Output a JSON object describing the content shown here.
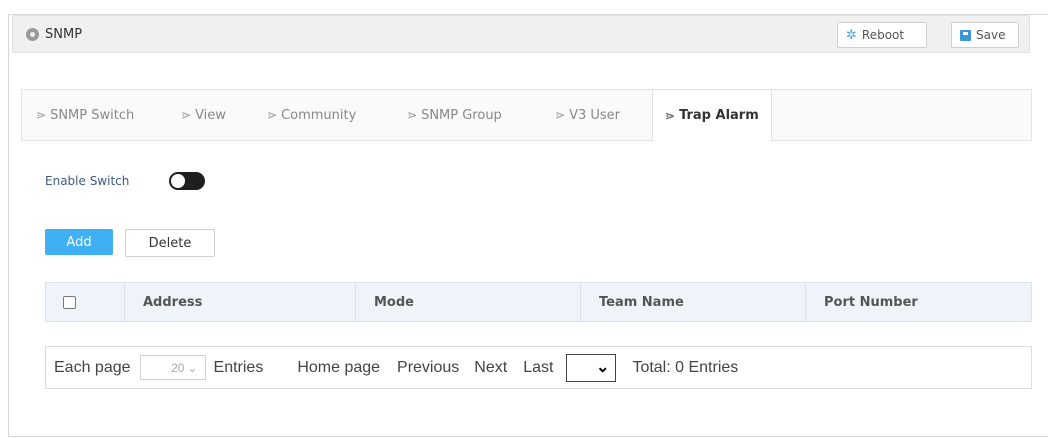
{
  "header": {
    "title": "SNMP",
    "reboot_label": "Reboot",
    "save_label": "Save"
  },
  "tabs": [
    {
      "label": "SNMP Switch",
      "active": false
    },
    {
      "label": "View",
      "active": false
    },
    {
      "label": "Community",
      "active": false
    },
    {
      "label": "SNMP Group",
      "active": false
    },
    {
      "label": "V3 User",
      "active": false
    },
    {
      "label": "Trap Alarm",
      "active": true
    }
  ],
  "enable_switch": {
    "label": "Enable Switch",
    "state": "off"
  },
  "actions": {
    "add_label": "Add",
    "delete_label": "Delete"
  },
  "table": {
    "columns": [
      "Address",
      "Mode",
      "Team Name",
      "Port Number"
    ],
    "rows": []
  },
  "pagination": {
    "each_page_label": "Each page",
    "page_size": "20",
    "entries_label": "Entries",
    "home_label": "Home page",
    "previous_label": "Previous",
    "next_label": "Next",
    "last_label": "Last",
    "total_label": "Total: 0 Entries"
  },
  "colors": {
    "accent": "#3fb0f3",
    "header_bg": "#f0f0f0",
    "table_header_bg": "#eef4fa",
    "label_blue": "#3d5a80"
  }
}
